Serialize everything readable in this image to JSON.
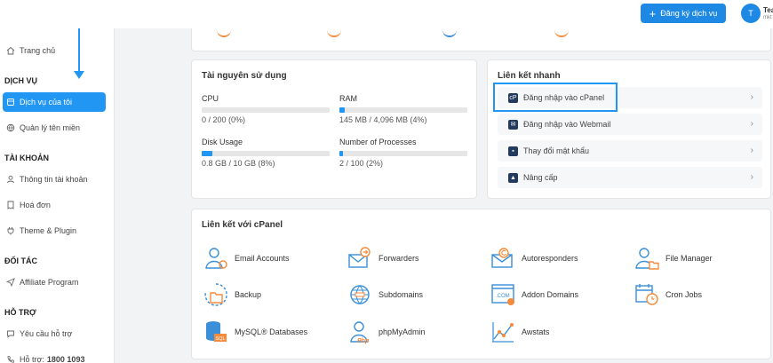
{
  "header": {
    "register_label": "Đăng ký dịch vụ",
    "avatar_letter": "T",
    "user_name": "Tea",
    "user_sub": "mkt"
  },
  "sidebar": {
    "home": "Trang chủ",
    "section_services": "DỊCH VỤ",
    "my_services": "Dịch vụ của tôi",
    "domains": "Quản lý tên miền",
    "section_account": "TÀI KHOẢN",
    "account_info": "Thông tin tài khoản",
    "invoices": "Hoá đơn",
    "themes": "Theme & Plugin",
    "section_partner": "ĐỐI TÁC",
    "affiliate": "Affiliate Program",
    "section_support": "HỖ TRỢ",
    "support_request": "Yêu cầu hỗ trợ",
    "hotline_prefix": "Hỗ trợ: ",
    "hotline_number": "1800 1093"
  },
  "resources": {
    "title": "Tài nguyên sử dụng",
    "items": [
      {
        "label": "CPU",
        "value": "0 / 200 (0%)",
        "percent": 0
      },
      {
        "label": "RAM",
        "value": "145 MB / 4,096 MB (4%)",
        "percent": 4
      },
      {
        "label": "Disk Usage",
        "value": "0.8 GB / 10 GB (8%)",
        "percent": 8
      },
      {
        "label": "Number of Processes",
        "value": "2 / 100 (2%)",
        "percent": 2
      }
    ]
  },
  "quick_links": {
    "title": "Liên kết nhanh",
    "items": [
      "Đăng nhập vào cPanel",
      "Đăng nhập vào Webmail",
      "Thay đổi mật khẩu",
      "Nâng cấp"
    ]
  },
  "cpanel_links": {
    "title": "Liên kết với cPanel",
    "items": [
      "Email Accounts",
      "Forwarders",
      "Autoresponders",
      "File Manager",
      "Backup",
      "Subdomains",
      "Addon Domains",
      "Cron Jobs",
      "MySQL® Databases",
      "phpMyAdmin",
      "Awstats"
    ]
  },
  "colors": {
    "accent": "#2196f3",
    "icon_orange": "#f58b3a",
    "icon_blue": "#3a8fd8"
  }
}
